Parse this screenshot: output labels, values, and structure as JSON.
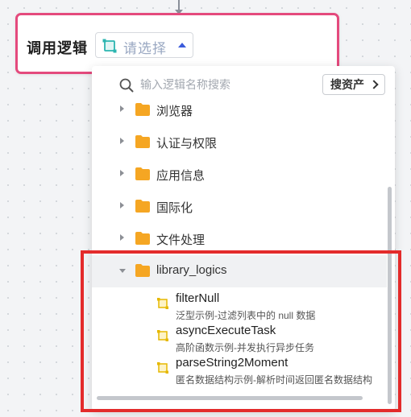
{
  "node": {
    "title": "调用逻辑"
  },
  "logic_select": {
    "placeholder": "请选择",
    "icon": "logic-icon"
  },
  "search": {
    "placeholder": "输入逻辑名称搜索",
    "asset_button": "搜资产"
  },
  "tree": {
    "folders": [
      {
        "label": "浏览器",
        "expanded": false
      },
      {
        "label": "认证与权限",
        "expanded": false
      },
      {
        "label": "应用信息",
        "expanded": false
      },
      {
        "label": "国际化",
        "expanded": false
      },
      {
        "label": "文件处理",
        "expanded": false
      },
      {
        "label": "library_logics",
        "expanded": true
      }
    ],
    "logics": [
      {
        "name": "filterNull",
        "desc": "泛型示例-过滤列表中的 null 数据"
      },
      {
        "name": "asyncExecuteTask",
        "desc": "高阶函数示例-并发执行异步任务"
      },
      {
        "name": "parseString2Moment",
        "desc": "匿名数据结构示例-解析时间返回匿名数据结构"
      }
    ]
  },
  "colors": {
    "node_border": "#e44a7d",
    "highlight": "#e32b2b",
    "folder": "#f5a623",
    "logic_icon": "#f2c12e",
    "select_icon": "#2bb5b0",
    "caret": "#3b5bdb"
  }
}
